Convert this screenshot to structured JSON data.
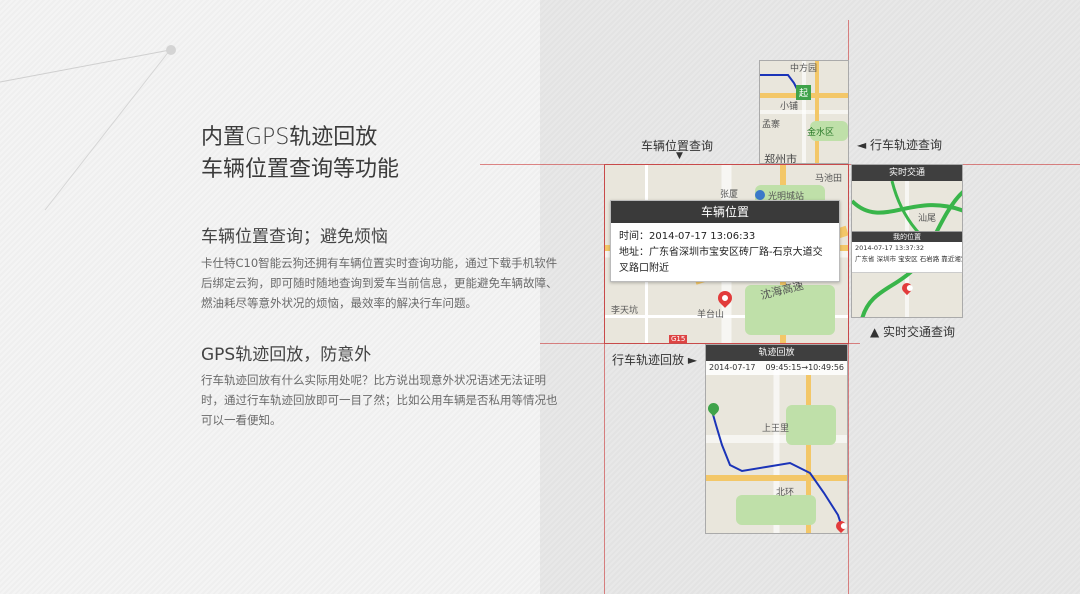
{
  "heading": {
    "line1": "内置GPS轨迹回放",
    "line2": "车辆位置查询等功能"
  },
  "section1": {
    "title": "车辆位置查询；避免烦恼",
    "body": "卡仕特C10智能云狗还拥有车辆位置实时查询功能，通过下载手机软件后绑定云狗，即可随时随地查询到爱车当前信息，更能避免车辆故障、燃油耗尽等意外状况的烦恼，最效率的解决行车问题。"
  },
  "section2": {
    "title": "GPS轨迹回放，防意外",
    "body": "行车轨迹回放有什么实际用处呢？比方说出现意外状况语述无法证明时，通过行车轨迹回放即可一目了然；比如公用车辆是否私用等情况也可以一看便知。"
  },
  "callouts": {
    "vehicle_query": "车辆位置查询",
    "vehicle_query_arrow": "▼",
    "track_right": "◄ 行车轨迹查询",
    "track_left": "行车轨迹回放 ►",
    "traffic_query": "▲ 实时交通查询"
  },
  "top_map": {
    "start_badge": "起",
    "labels": [
      "小铺",
      "金水区",
      "郑州市",
      "孟寨",
      "中方园"
    ]
  },
  "main_map": {
    "labels": [
      "马池田",
      "张厦",
      "光明城站",
      "李天坑",
      "羊台山",
      "沈海高速",
      "G15"
    ],
    "card": {
      "title": "车辆位置",
      "time": "时间：2014-07-17 13:06:33",
      "address": "地址：广东省深圳市宝安区砖厂路-石京大道交叉路口附近"
    }
  },
  "traffic_panel": {
    "header": "实时交通",
    "sub_header": "我的位置",
    "time": "2014-07-17 13:37:32",
    "address": "广东省 深圳市 宝安区 石岩路 靠近湘堂",
    "labels": [
      "汕尾"
    ]
  },
  "track_panel": {
    "header": "轨迹回放",
    "date": "2014-07-17",
    "time_range": "09:45:15→10:49:56",
    "labels": [
      "上王里",
      "北环"
    ]
  },
  "colors": {
    "accent_red": "#c84a4a",
    "map_bg": "#e9e6dc",
    "road_yellow": "#f3c768",
    "header_dark": "#3a3a3a",
    "route_blue": "#1b34b8",
    "start_green": "#3fa34a"
  }
}
